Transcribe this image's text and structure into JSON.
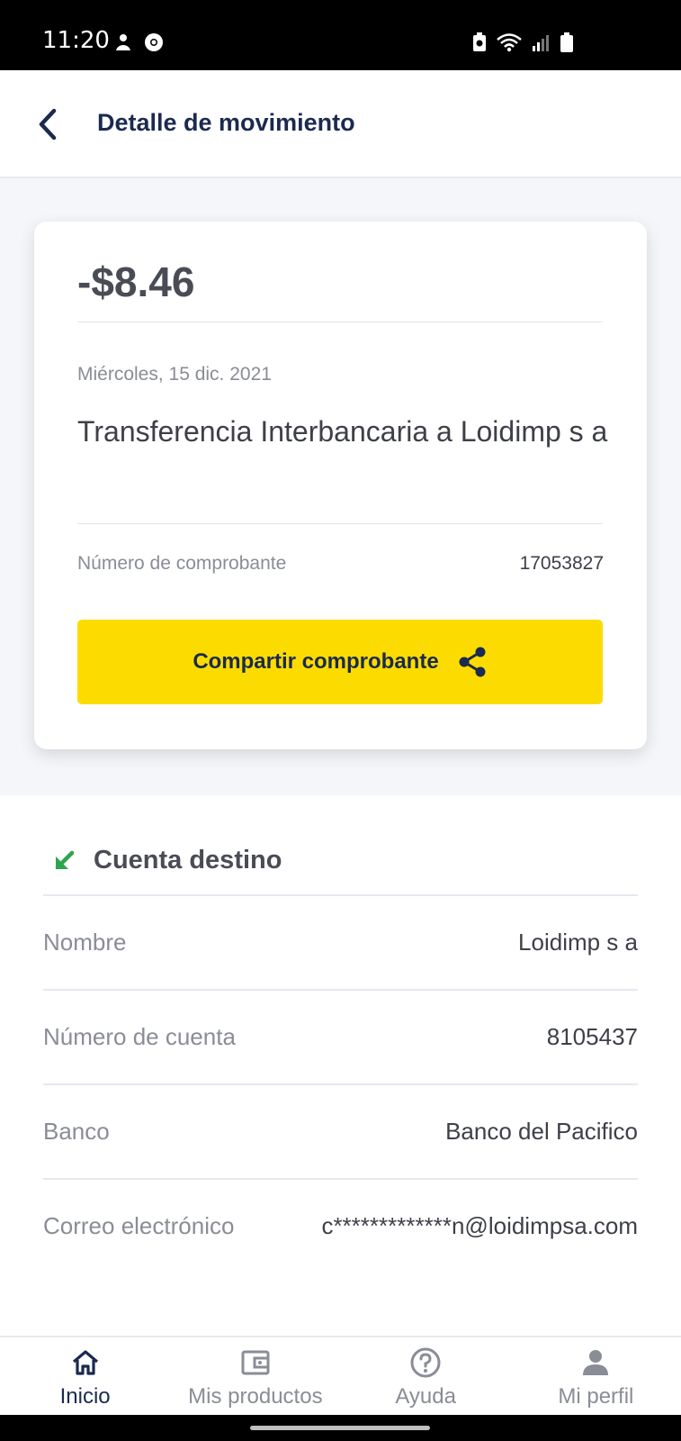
{
  "status_bar": {
    "time": "11:20",
    "icons": [
      "notification-icon",
      "chrome-icon",
      "battery-saver-icon",
      "wifi-icon",
      "signal-icon",
      "battery-icon"
    ]
  },
  "header": {
    "title": "Detalle de movimiento",
    "back_icon": "chevron-left-icon"
  },
  "summary": {
    "amount": "-$8.46",
    "date": "Miércoles, 15 dic. 2021",
    "description": "Transferencia Interbancaria a Loidimp s a",
    "receipt_label": "Número de comprobante",
    "receipt_number": "17053827",
    "share_button_label": "Compartir comprobante",
    "share_icon": "share-icon"
  },
  "destination": {
    "title": "Cuenta destino",
    "icon": "arrow-down-left-icon",
    "rows": [
      {
        "label": "Nombre",
        "value": "Loidimp s a"
      },
      {
        "label": "Número de cuenta",
        "value": "8105437"
      },
      {
        "label": "Banco",
        "value": "Banco del Pacifico"
      },
      {
        "label": "Correo electrónico",
        "value": "c*************n@loidimpsa.com"
      }
    ]
  },
  "bottom_nav": {
    "items": [
      {
        "label": "Inicio",
        "icon": "home-icon",
        "active": true
      },
      {
        "label": "Mis productos",
        "icon": "wallet-icon",
        "active": false
      },
      {
        "label": "Ayuda",
        "icon": "help-icon",
        "active": false
      },
      {
        "label": "Mi perfil",
        "icon": "profile-icon",
        "active": false
      }
    ]
  },
  "colors": {
    "brand_navy": "#1b2a4e",
    "accent_yellow": "#fcdc00",
    "incoming_green": "#2ea44f",
    "background_gray": "#f4f6fa"
  }
}
